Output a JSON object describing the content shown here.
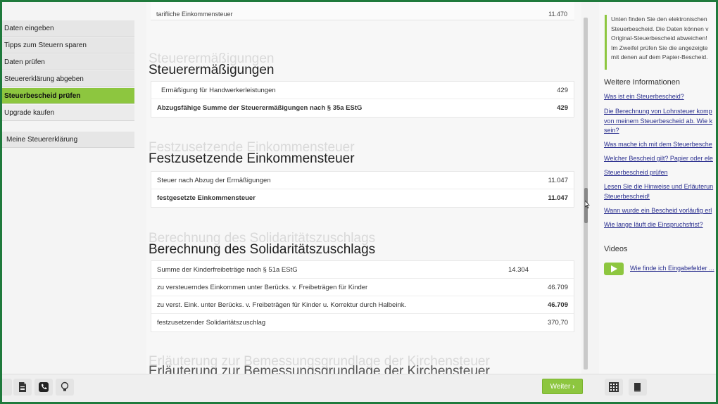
{
  "sidebar": {
    "items": [
      {
        "label": "Daten eingeben"
      },
      {
        "label": "Tipps zum Steuern sparen"
      },
      {
        "label": "Daten prüfen"
      },
      {
        "label": "Steuererklärung abgeben"
      },
      {
        "label": "Steuerbescheid prüfen"
      },
      {
        "label": "Upgrade kaufen"
      }
    ],
    "active_index": 4,
    "my_declaration": "Meine Steuererklärung"
  },
  "main": {
    "top_row": {
      "label": "tarifliche Einkommensteuer",
      "value": "11.470"
    },
    "sections": [
      {
        "title": "Steuerermäßigungen",
        "rows": [
          {
            "label": "Ermäßigung für Handwerkerleistungen",
            "value": "429",
            "bold": false
          },
          {
            "label": "Abzugsfähige Summe der Steuerermäßigungen nach § 35a EStG",
            "value": "429",
            "bold": true
          }
        ]
      },
      {
        "title": "Festzusetzende Einkommensteuer",
        "rows": [
          {
            "label": "Steuer nach Abzug der Ermäßigungen",
            "value": "11.047",
            "bold": false
          },
          {
            "label": "festgesetzte Einkommensteuer",
            "value": "11.047",
            "bold": true
          }
        ]
      },
      {
        "title": "Berechnung des Solidaritätszuschlags",
        "rows": [
          {
            "label": "Summe der Kinderfreibeträge nach § 51a EStG",
            "mid": "14.304",
            "value": "",
            "bold": false
          },
          {
            "label": "zu versteuerndes Einkommen unter Berücks. v. Freibeträgen für Kinder",
            "value": "46.709",
            "bold": false
          },
          {
            "label": "zu verst. Eink. unter Berücks. v. Freibeträgen für Kinder u. Korrektur durch Halbeink.",
            "value": "46.709",
            "value_bold": true,
            "bold": false
          },
          {
            "label": "festzusetzender Solidaritätszuschlag",
            "value": "370,70",
            "bold": false
          }
        ]
      }
    ],
    "next_section_title": "Erläuterung zur Bemessungsgrundlage der Kirchensteuer"
  },
  "right": {
    "info_lines": [
      "Unten finden Sie den elektronischen",
      "Steuerbescheid. Die Daten können v",
      "Original-Steuerbescheid abweichen!",
      "Im Zweifel prüfen Sie die angezeigte",
      "mit denen auf dem Papier-Bescheid."
    ],
    "more_info_heading": "Weitere Informationen",
    "links": [
      [
        "Was ist ein Steuerbescheid?"
      ],
      [
        "Die Berechnung von Lohnsteuer komp",
        "von meinem Steuerbescheid ab. Wie k",
        "sein?"
      ],
      [
        "Was mache ich mit dem Steuerbesche"
      ],
      [
        "Welcher Bescheid gilt? Papier oder ele"
      ],
      [
        "Steuerbescheid prüfen"
      ],
      [
        "Lesen Sie die Hinweise und Erläuterun",
        "Steuerbescheid!"
      ],
      [
        "Wann wurde ein Bescheid vorläufig erl"
      ],
      [
        "Wie lange läuft die Einspruchsfrist?"
      ]
    ],
    "videos_heading": "Videos",
    "video_link": "Wie finde ich Eingabefelder ..."
  },
  "bottom": {
    "next_button": "Weiter",
    "icons": [
      "document-icon",
      "phone-icon",
      "lightbulb-icon",
      "calculator-icon",
      "book-icon"
    ]
  },
  "colors": {
    "accent": "#8dc63f",
    "link": "#2a2f8f",
    "frame": "#1f7a3c"
  }
}
